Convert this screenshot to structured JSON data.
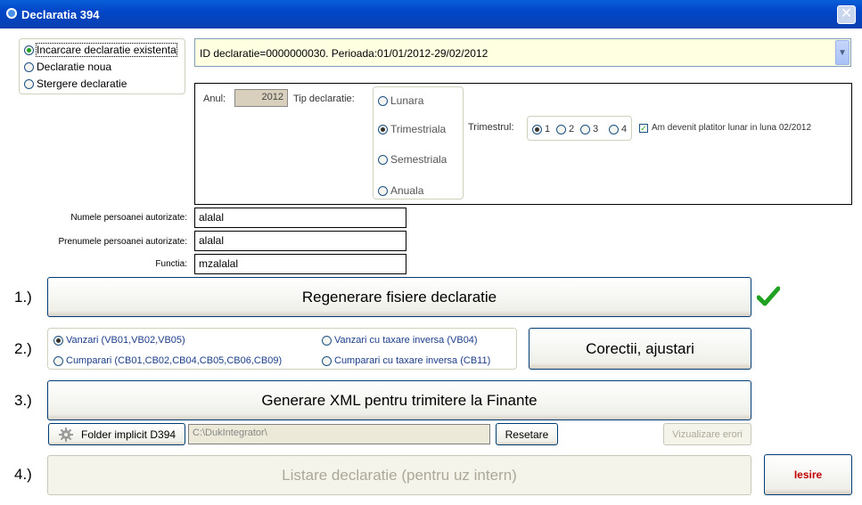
{
  "window": {
    "title": "Declaratia 394"
  },
  "mode": {
    "options": [
      "Incarcare declaratie existenta",
      "Declaratie noua",
      "Stergere declaratie"
    ],
    "selected": 0
  },
  "declaration_combo": {
    "value": "ID declaratie=0000000030. Perioada:01/01/2012-29/02/2012"
  },
  "year": {
    "label": "Anul:",
    "value": "2012"
  },
  "tip": {
    "label": "Tip declaratie:",
    "options": [
      "Lunara",
      "Trimestriala",
      "Semestriala",
      "Anuala"
    ],
    "selected": 1
  },
  "trimestrul": {
    "label": "Trimestrul:",
    "options": [
      "1",
      "2",
      "3",
      "4"
    ],
    "selected": 0
  },
  "platitor_check": {
    "label": "Am devenit platitor lunar in luna 02/2012",
    "checked": true
  },
  "person": {
    "nume_label": "Numele persoanei autorizate:",
    "nume_value": "alalal",
    "prenume_label": "Prenumele persoanei autorizate:",
    "prenume_value": "alalal",
    "functia_label": "Functia:",
    "functia_value": "mzalalal"
  },
  "steps": {
    "s1": "1.)",
    "s2": "2.)",
    "s3": "3.)",
    "s4": "4.)"
  },
  "buttons": {
    "regenerare": "Regenerare fisiere declaratie",
    "corectii": "Corectii, ajustari",
    "generare_xml": "Generare XML pentru trimitere la Finante",
    "folder_implicit": "Folder implicit D394",
    "resetare": "Resetare",
    "vizualizare": "Vizualizare erori",
    "listare": "Listare declaratie (pentru uz intern)",
    "iesire": "Iesire"
  },
  "ops": {
    "options": [
      "Vanzari (VB01,VB02,VB05)",
      "Vanzari cu taxare inversa (VB04)",
      "Cumparari (CB01,CB02,CB04,CB05,CB06,CB09)",
      "Cumparari cu taxare inversa (CB11)"
    ],
    "selected": 0
  },
  "folder_path": {
    "value": "C:\\DukIntegrator\\"
  },
  "colors": {
    "accent": "#0046c8",
    "check_green": "#21a121",
    "iesire_text": "#c00000",
    "combo_bg": "#ffffe1"
  },
  "icons": [
    "app-icon",
    "close-icon",
    "dropdown-arrow-icon",
    "gear-icon",
    "green-check-icon"
  ]
}
